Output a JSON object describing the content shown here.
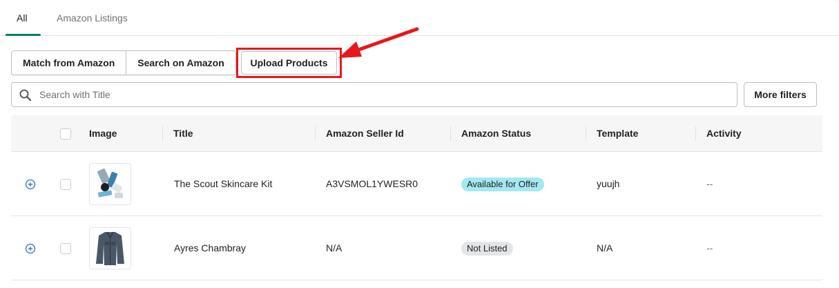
{
  "tabs": [
    {
      "label": "All",
      "active": true
    },
    {
      "label": "Amazon Listings",
      "active": false
    }
  ],
  "toolbar": {
    "match_label": "Match from Amazon",
    "search_amazon_label": "Search on Amazon",
    "upload_label": "Upload Products",
    "highlight_color": "#e8171c"
  },
  "search": {
    "placeholder": "Search with Title",
    "value": "",
    "more_filters_label": "More filters"
  },
  "table": {
    "headers": {
      "image": "Image",
      "title": "Title",
      "seller_id": "Amazon Seller Id",
      "status": "Amazon Status",
      "template": "Template",
      "activity": "Activity"
    },
    "rows": [
      {
        "image_icon": "skincare-kit-thumbnail",
        "title": "The Scout Skincare Kit",
        "seller_id": "A3VSMOL1YWESR0",
        "status": "Available for Offer",
        "template": "yuujh",
        "activity": "--"
      },
      {
        "image_icon": "shirt-thumbnail",
        "title": "Ayres Chambray",
        "seller_id": "N/A",
        "status": "Not Listed",
        "template": "N/A",
        "activity": "--"
      }
    ]
  },
  "colors": {
    "accent": "#008060",
    "link": "#2c6ecb",
    "available_badge": "#a4e8f2",
    "not_listed_badge": "#e4e5e7"
  }
}
